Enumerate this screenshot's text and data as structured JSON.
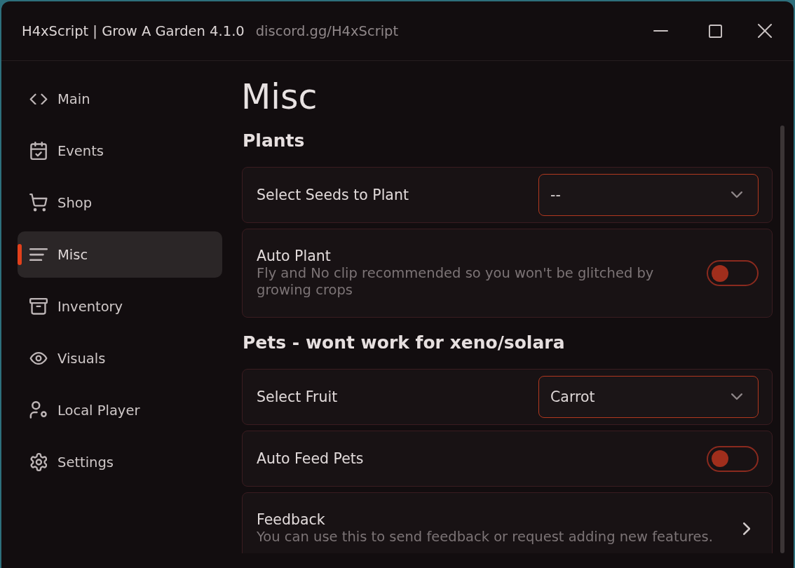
{
  "window": {
    "title": "H4xScript | Grow A Garden 4.1.0",
    "link": "discord.gg/H4xScript"
  },
  "sidebar": {
    "items": [
      {
        "label": "Main",
        "selected": false
      },
      {
        "label": "Events",
        "selected": false
      },
      {
        "label": "Shop",
        "selected": false
      },
      {
        "label": "Misc",
        "selected": true
      },
      {
        "label": "Inventory",
        "selected": false
      },
      {
        "label": "Visuals",
        "selected": false
      },
      {
        "label": "Local Player",
        "selected": false
      },
      {
        "label": "Settings",
        "selected": false
      }
    ]
  },
  "page": {
    "title": "Misc",
    "sections": [
      {
        "title": "Plants",
        "rows": [
          {
            "kind": "dropdown",
            "label": "Select Seeds to Plant",
            "value": "--"
          },
          {
            "kind": "toggle",
            "label": "Auto Plant",
            "description": "Fly and No clip recommended so you won't be glitched by growing crops",
            "on": false
          }
        ]
      },
      {
        "title": "Pets - wont work for xeno/solara",
        "rows": [
          {
            "kind": "dropdown",
            "label": "Select Fruit",
            "value": "Carrot"
          },
          {
            "kind": "toggle",
            "label": "Auto Feed Pets",
            "on": false
          },
          {
            "kind": "link",
            "label": "Feedback",
            "description": "You can use this to send feedback or request adding new features."
          }
        ]
      }
    ]
  }
}
